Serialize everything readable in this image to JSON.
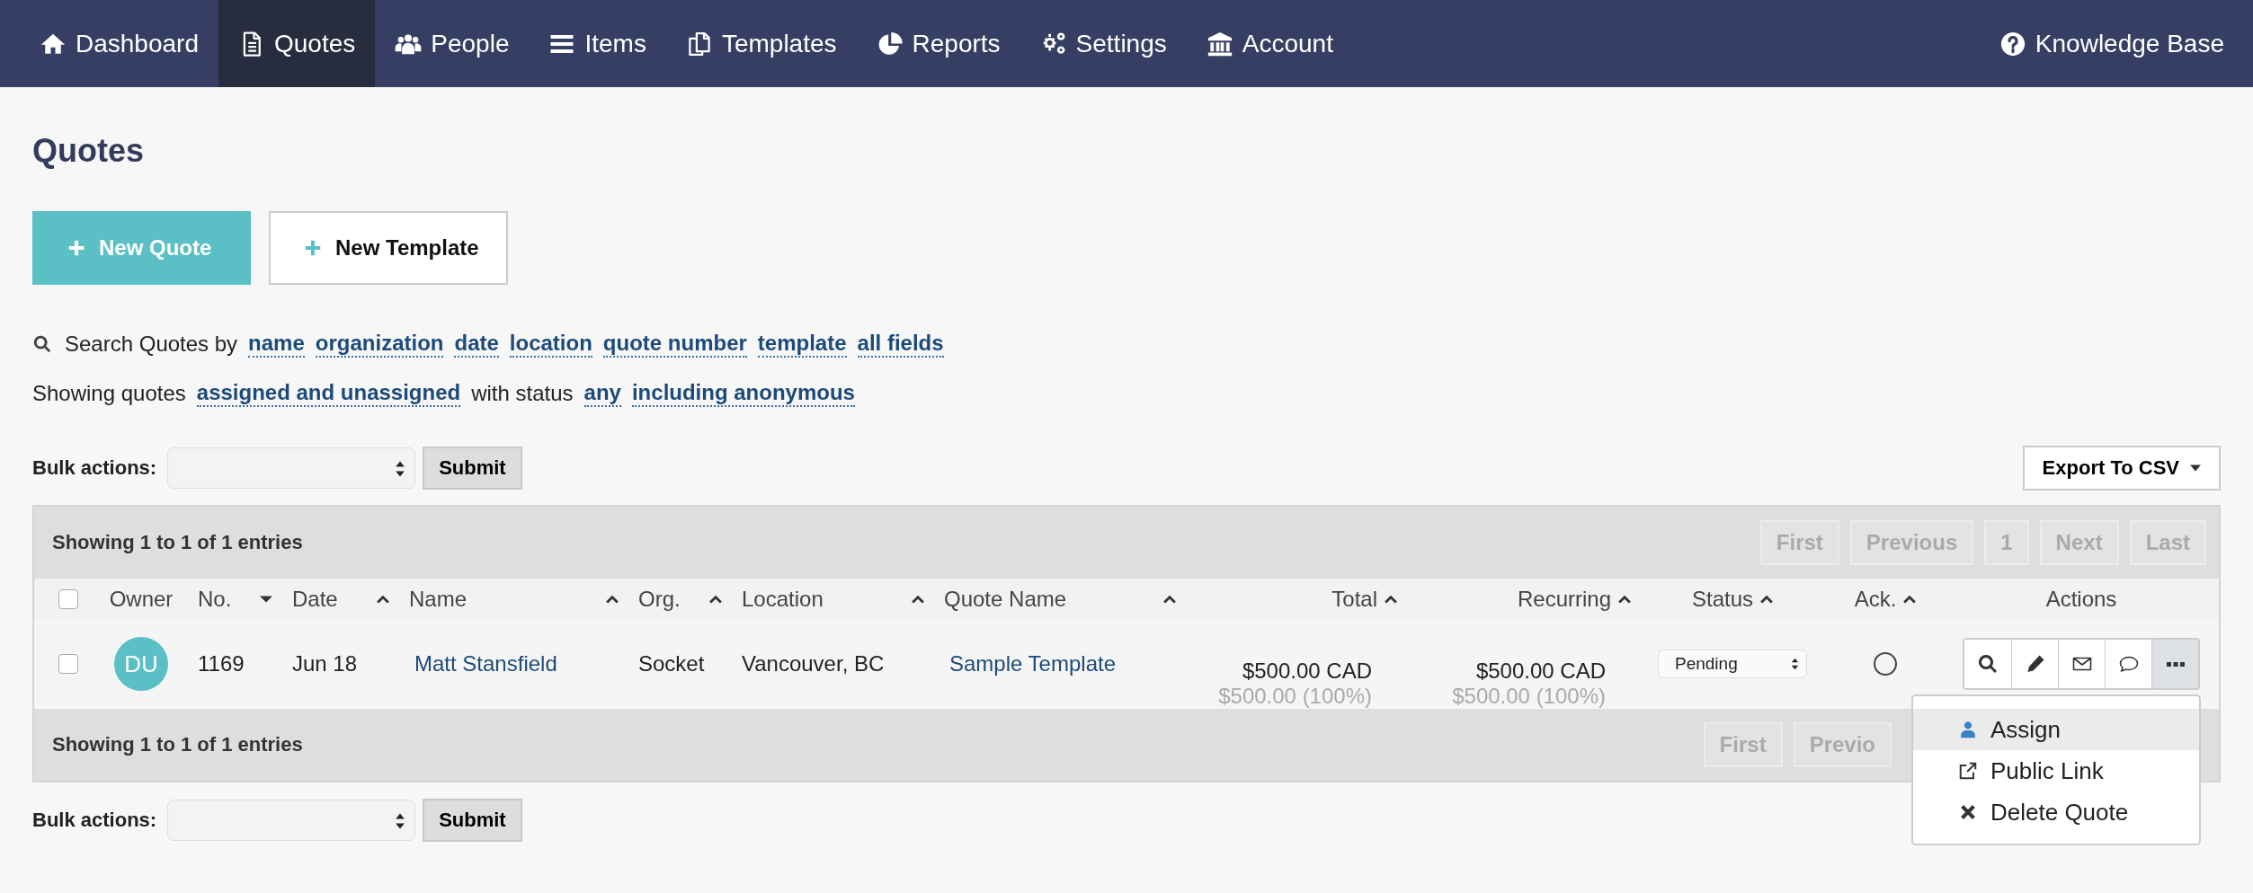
{
  "nav": {
    "items": [
      {
        "label": "Dashboard",
        "selected": false
      },
      {
        "label": "Quotes",
        "selected": true
      },
      {
        "label": "People",
        "selected": false
      },
      {
        "label": "Items",
        "selected": false
      },
      {
        "label": "Templates",
        "selected": false
      },
      {
        "label": "Reports",
        "selected": false
      },
      {
        "label": "Settings",
        "selected": false
      },
      {
        "label": "Account",
        "selected": false
      }
    ],
    "right": {
      "label": "Knowledge Base"
    }
  },
  "page_title": "Quotes",
  "buttons": [
    {
      "label": "New Quote",
      "kind": "primary"
    },
    {
      "label": "New Template",
      "kind": "secondary"
    }
  ],
  "search": {
    "prefix": "Search Quotes by",
    "fields": [
      "name",
      "organization",
      "date",
      "location",
      "quote number",
      "template",
      "all fields"
    ]
  },
  "filter": [
    {
      "kind": "text",
      "text": "Showing quotes"
    },
    {
      "kind": "link",
      "text": "assigned and unassigned"
    },
    {
      "kind": "text",
      "text": "with status"
    },
    {
      "kind": "link",
      "text": "any"
    },
    {
      "kind": "link",
      "text": "including anonymous"
    }
  ],
  "bulk_top": {
    "label": "Bulk actions:",
    "submit": "Submit"
  },
  "export_button": "Export To CSV",
  "table": {
    "info": "Showing 1 to 1 of 1 entries",
    "pagination": [
      {
        "label": "First",
        "disabled": true
      },
      {
        "label": "Previous",
        "disabled": true
      },
      {
        "label": "1",
        "disabled": true
      },
      {
        "label": "Next",
        "disabled": true
      },
      {
        "label": "Last",
        "disabled": true
      }
    ],
    "select_all": {
      "checked": false
    },
    "columns": [
      {
        "label": "Owner",
        "kind": "plain"
      },
      {
        "label": "No.",
        "kind": "sort-desc"
      },
      {
        "label": "Date",
        "kind": "sort-asc"
      },
      {
        "label": "Name",
        "kind": "sort-asc"
      },
      {
        "label": "Org.",
        "kind": "sort-asc"
      },
      {
        "label": "Location",
        "kind": "sort-asc"
      },
      {
        "label": "Quote Name",
        "kind": "sort-asc"
      },
      {
        "label": "Total",
        "kind": "sort-asc"
      },
      {
        "label": "Recurring",
        "kind": "sort-asc"
      },
      {
        "label": "Status",
        "kind": "sort-asc"
      },
      {
        "label": "Ack.",
        "kind": "sort-asc"
      },
      {
        "label": "Actions",
        "kind": "plain"
      }
    ],
    "rows": [
      {
        "checked": false,
        "owner": "DU",
        "number": "1169",
        "date": "Jun 18",
        "name": "Matt Stansfield",
        "org": "Socket",
        "location": "Vancouver, BC",
        "quote_name": "Sample Template",
        "total": "$500.00 CAD",
        "total_sub": "$500.00 (100%)",
        "recurring": "$500.00 CAD",
        "recurring_sub": "$500.00 (100%)",
        "status": "Pending",
        "acknowledged": false,
        "actions": [
          {
            "selected": false
          },
          {
            "selected": false
          },
          {
            "selected": false
          },
          {
            "selected": false
          },
          {
            "selected": true
          }
        ]
      }
    ],
    "footer_info": "Showing 1 to 1 of 1 entries",
    "footer_pagination": [
      {
        "label": "First",
        "disabled": true
      },
      {
        "label": "Previo",
        "disabled": true
      }
    ]
  },
  "menu": [
    {
      "label": "Assign",
      "selected": true
    },
    {
      "label": "Public Link",
      "selected": false
    },
    {
      "label": "Delete Quote",
      "selected": false
    }
  ],
  "bulk_bottom": {
    "label": "Bulk actions:",
    "submit": "Submit"
  }
}
